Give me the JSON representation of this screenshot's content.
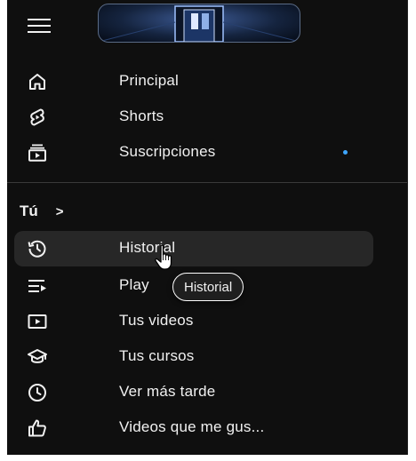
{
  "colors": {
    "background": "#0f0f0f",
    "text": "#f1f1f1",
    "active_row": "#272727",
    "badge_dot": "#3ea6ff",
    "divider": "#3a3a3a"
  },
  "header": {
    "menu_icon": "hamburger-menu-icon",
    "thumbnail": "video-thumbnail-image"
  },
  "nav": {
    "items": [
      {
        "label": "Principal",
        "icon": "home-icon"
      },
      {
        "label": "Shorts",
        "icon": "shorts-icon"
      },
      {
        "label": "Suscripciones",
        "icon": "subscriptions-icon",
        "has_new_badge": true
      }
    ]
  },
  "you_section": {
    "title": "Tú",
    "chevron": ">",
    "items": [
      {
        "label": "Historial",
        "icon": "history-icon",
        "active": true
      },
      {
        "label": "Play",
        "icon": "playlist-icon"
      },
      {
        "label": "Tus videos",
        "icon": "your-videos-icon"
      },
      {
        "label": "Tus cursos",
        "icon": "courses-icon"
      },
      {
        "label": "Ver más tarde",
        "icon": "clock-icon"
      },
      {
        "label": "Videos que me gus...",
        "icon": "thumbs-up-icon"
      }
    ]
  },
  "tooltip": {
    "text": "Historial"
  }
}
